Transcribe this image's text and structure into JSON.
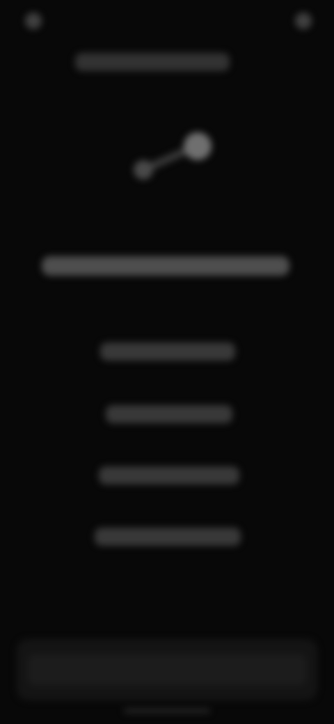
{
  "status_bar": {
    "left_text": "",
    "right_text": ""
  },
  "header": {
    "label": ""
  },
  "hero": {
    "icon": "music-note-icon",
    "title": ""
  },
  "menu": {
    "items": [
      {
        "label": ""
      },
      {
        "label": ""
      },
      {
        "label": ""
      },
      {
        "label": ""
      }
    ]
  },
  "bottom_panel": {
    "label": ""
  },
  "colors": {
    "background": "#080808",
    "text_soft": "#7a7a7a",
    "panel": "#161616"
  }
}
